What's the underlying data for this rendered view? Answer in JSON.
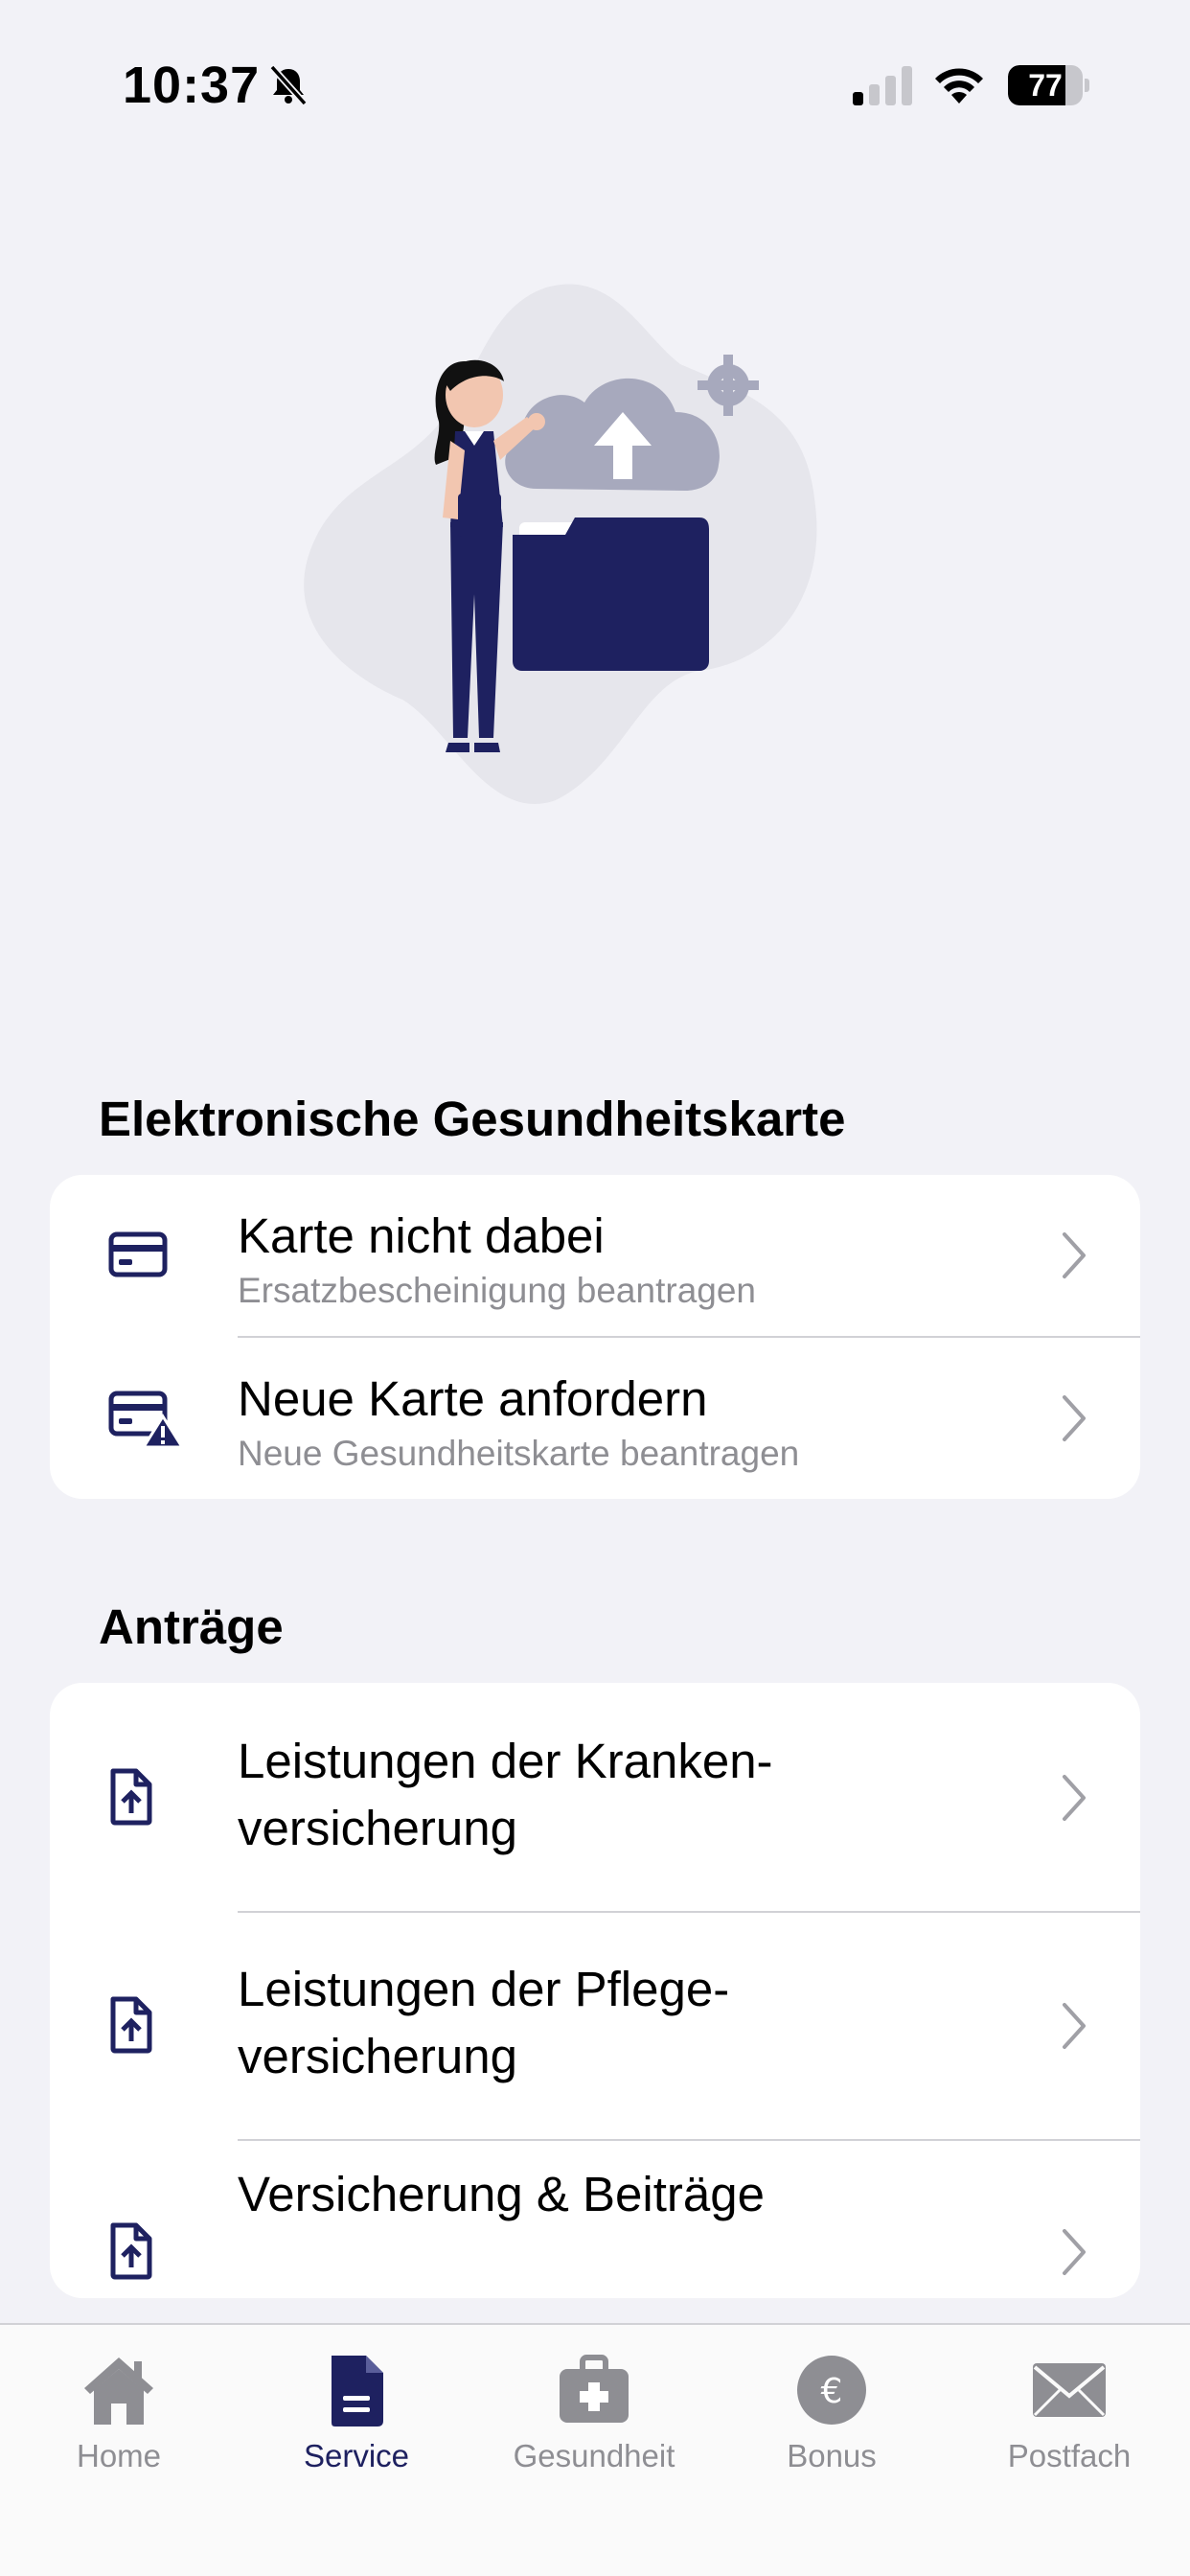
{
  "status_bar": {
    "time": "10:37",
    "battery": "77",
    "battery_level_percent": 77
  },
  "sections": {
    "egk": {
      "title": "Elektronische Gesundheitskarte",
      "items": [
        {
          "title": "Karte nicht dabei",
          "subtitle": "Ersatzbescheinigung beantragen",
          "icon": "card-icon"
        },
        {
          "title": "Neue Karte anfordern",
          "subtitle": "Neue Gesundheitskarte beantragen",
          "icon": "card-warning-icon"
        }
      ]
    },
    "antraege": {
      "title": "Anträge",
      "items": [
        {
          "title_line1": "Leistungen der Kranken-",
          "title_line2": "versicherung",
          "icon": "document-upload-icon"
        },
        {
          "title_line1": "Leistungen der Pflege-",
          "title_line2": "versicherung",
          "icon": "document-upload-icon"
        },
        {
          "title_line1": "Versicherung & Beiträge",
          "icon": "document-upload-icon"
        }
      ]
    }
  },
  "tabbar": {
    "tabs": [
      {
        "label": "Home",
        "icon": "house-icon",
        "active": false
      },
      {
        "label": "Service",
        "icon": "document-icon",
        "active": true
      },
      {
        "label": "Gesundheit",
        "icon": "medical-bag-icon",
        "active": false
      },
      {
        "label": "Bonus",
        "icon": "euro-icon",
        "active": false
      },
      {
        "label": "Postfach",
        "icon": "mail-icon",
        "active": false
      }
    ]
  },
  "colors": {
    "accent": "#1e2160",
    "background": "#f2f2f7",
    "inactive": "#8e8e93"
  }
}
